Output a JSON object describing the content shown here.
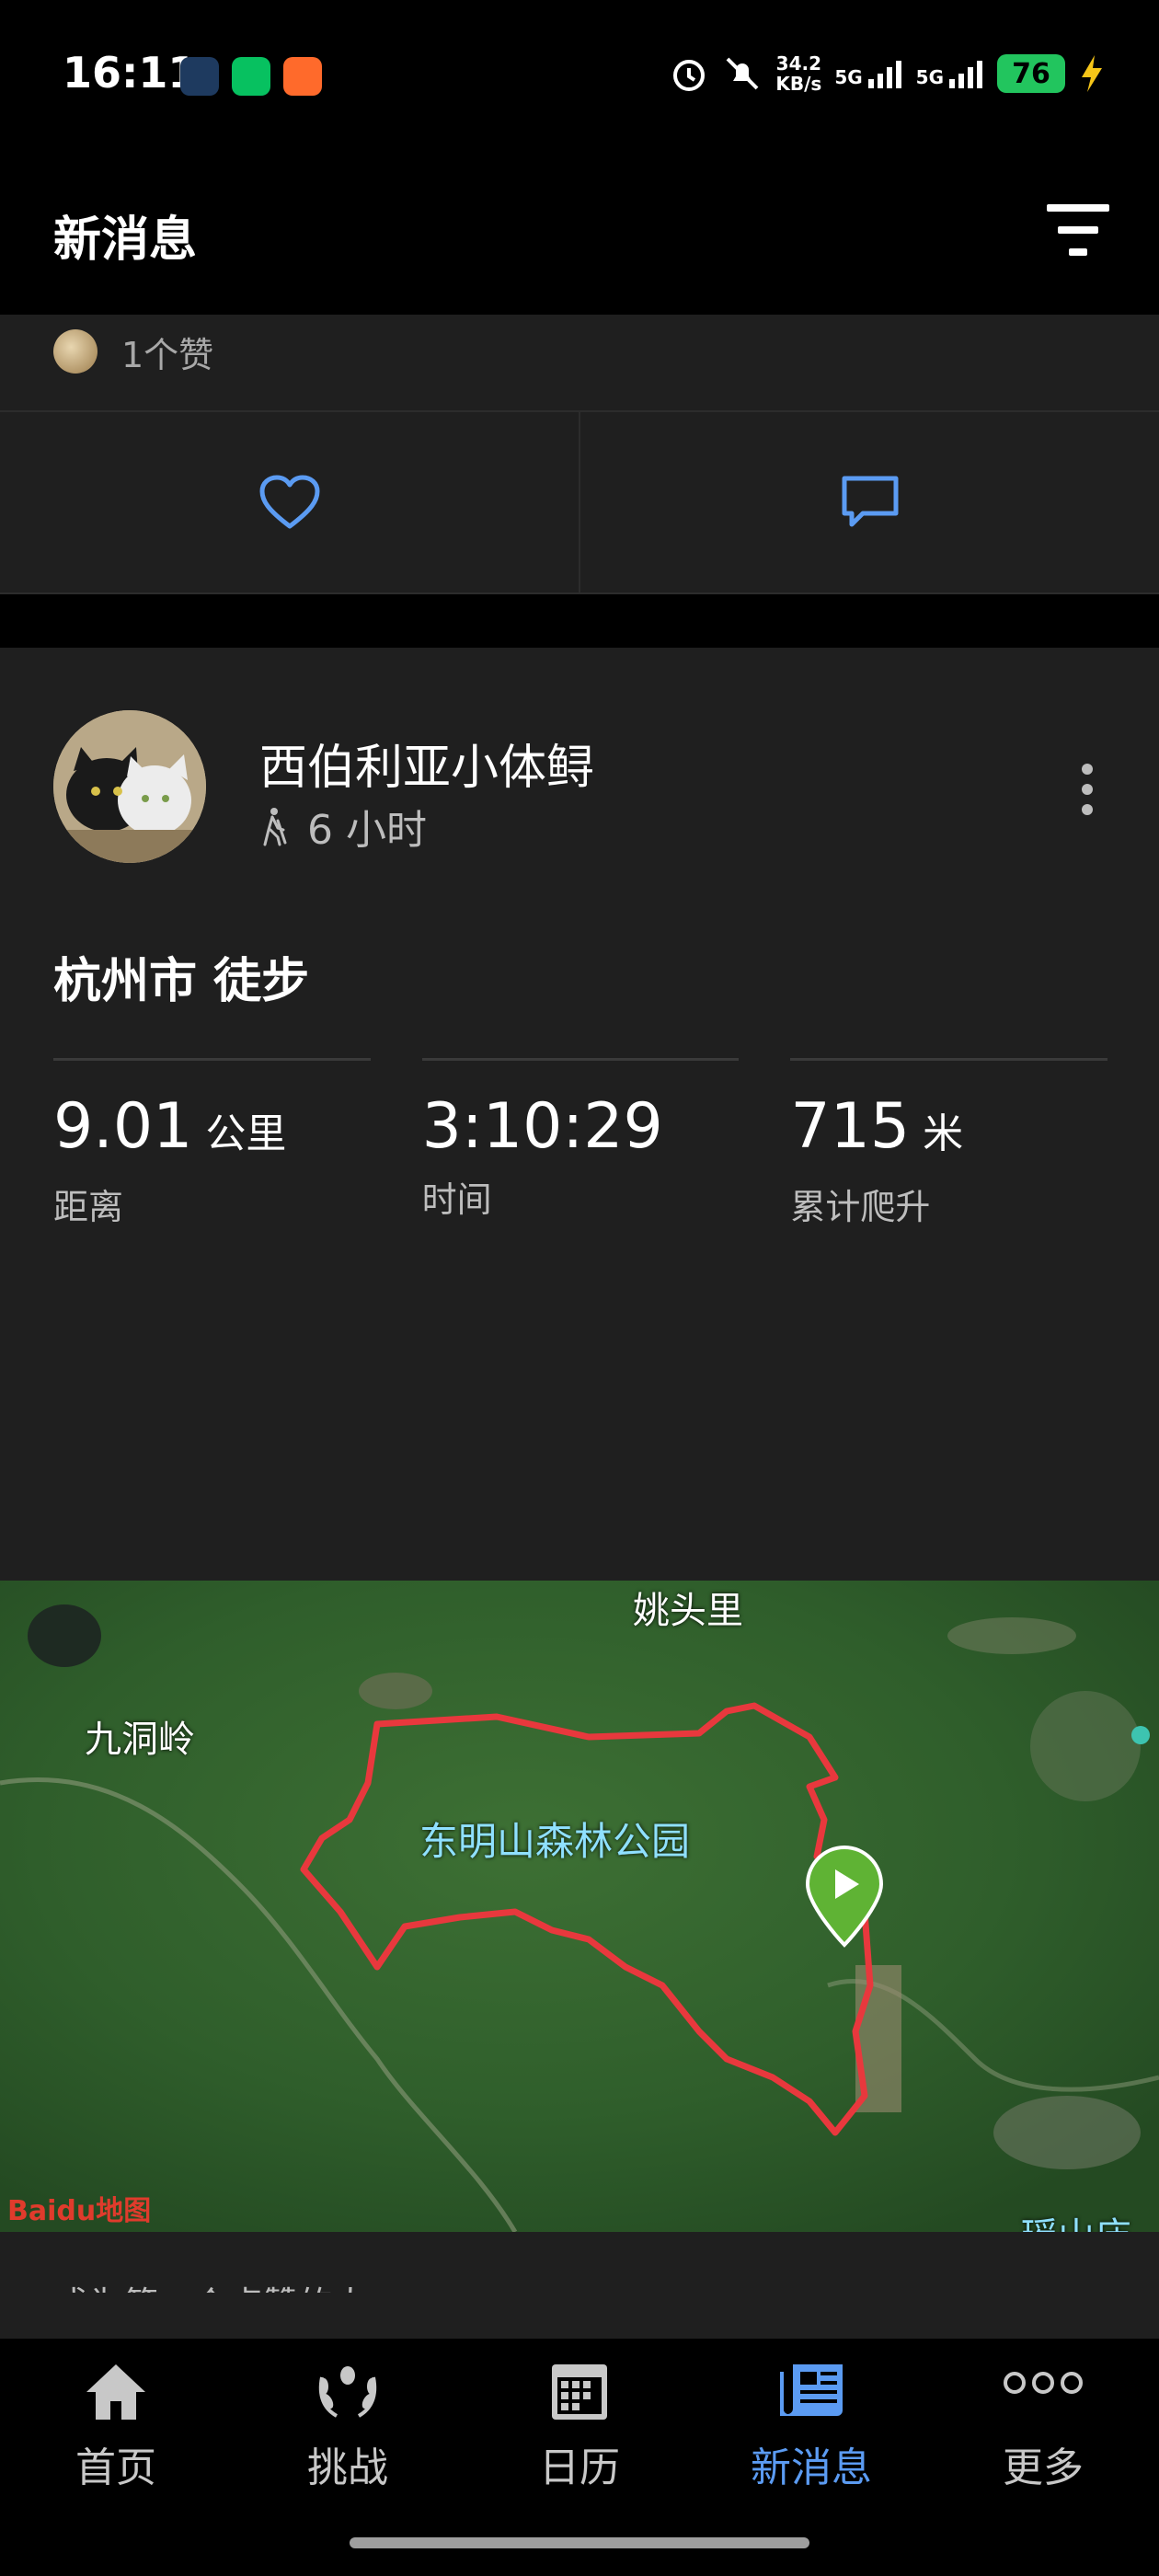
{
  "status_bar": {
    "time": "16:11",
    "net_speed_value": "34.2",
    "net_speed_unit": "KB/s",
    "signal_1": "5G",
    "signal_2": "5G",
    "battery": "76"
  },
  "header": {
    "title": "新消息"
  },
  "prev_card": {
    "likes_text": "1个赞"
  },
  "post": {
    "username": "西伯利亚小体鲟",
    "time_ago": "6 小时",
    "activity_title": "杭州市 徒步",
    "stats": [
      {
        "value": "9.01",
        "unit": "公里",
        "label": "距离"
      },
      {
        "value": "3:10:29",
        "unit": "",
        "label": "时间"
      },
      {
        "value": "715",
        "unit": "米",
        "label": "累计爬升"
      }
    ],
    "map_labels": {
      "top": "姚头里",
      "left": "九洞岭",
      "park": "东明山森林公园",
      "bottom_right": "瑶山庙"
    },
    "map_logo": "Baidu地图",
    "first_like_text": "成为第一个点赞的人"
  },
  "bottom_nav": [
    {
      "label": "首页",
      "icon": "home-icon"
    },
    {
      "label": "挑战",
      "icon": "laurel-icon"
    },
    {
      "label": "日历",
      "icon": "calendar-icon"
    },
    {
      "label": "新消息",
      "icon": "news-icon",
      "active": true
    },
    {
      "label": "更多",
      "icon": "more-dots-icon"
    }
  ],
  "colors": {
    "accent": "#5b9bf2",
    "route": "#e8383d",
    "map_pin": "#5fb334",
    "card_bg": "#1f1f1f"
  }
}
